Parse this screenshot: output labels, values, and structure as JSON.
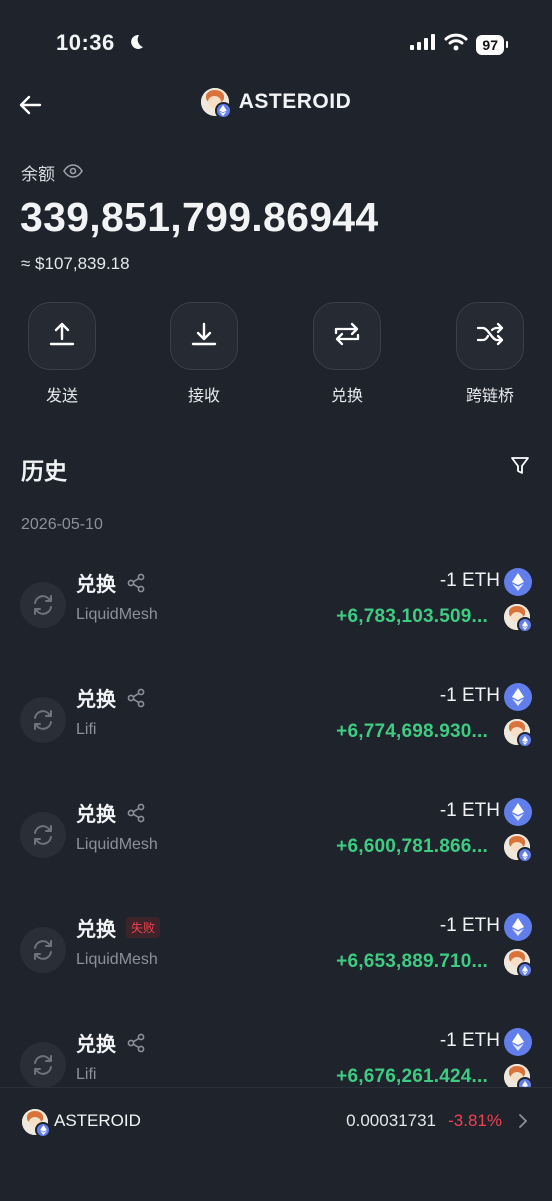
{
  "status_bar": {
    "time": "10:36",
    "battery": "97"
  },
  "header": {
    "title": "ASTEROID"
  },
  "balance": {
    "label": "余额",
    "amount": "339,851,799.86944",
    "usd": "≈ $107,839.18"
  },
  "actions": [
    {
      "label": "发送",
      "icon": "upload-icon"
    },
    {
      "label": "接收",
      "icon": "download-icon"
    },
    {
      "label": "兑换",
      "icon": "swap-icon"
    },
    {
      "label": "跨链桥",
      "icon": "shuffle-icon"
    }
  ],
  "history": {
    "title": "历史",
    "date": "2026-05-10",
    "items": [
      {
        "type": "兑换",
        "provider": "LiquidMesh",
        "out": "-1 ETH",
        "in": "+6,783,103.509...",
        "status": ""
      },
      {
        "type": "兑换",
        "provider": "Lifi",
        "out": "-1 ETH",
        "in": "+6,774,698.930...",
        "status": ""
      },
      {
        "type": "兑换",
        "provider": "LiquidMesh",
        "out": "-1 ETH",
        "in": "+6,600,781.866...",
        "status": ""
      },
      {
        "type": "兑换",
        "provider": "LiquidMesh",
        "out": "-1 ETH",
        "in": "+6,653,889.710...",
        "status": "失败"
      },
      {
        "type": "兑换",
        "provider": "Lifi",
        "out": "-1 ETH",
        "in": "+6,676,261.424...",
        "status": ""
      }
    ]
  },
  "bottom_bar": {
    "name": "ASTEROID",
    "price": "0.00031731",
    "change": "-3.81%"
  },
  "colors": {
    "background": "#1f232c",
    "positive": "#3ecb82",
    "negative": "#f0414f",
    "eth": "#627eea"
  }
}
